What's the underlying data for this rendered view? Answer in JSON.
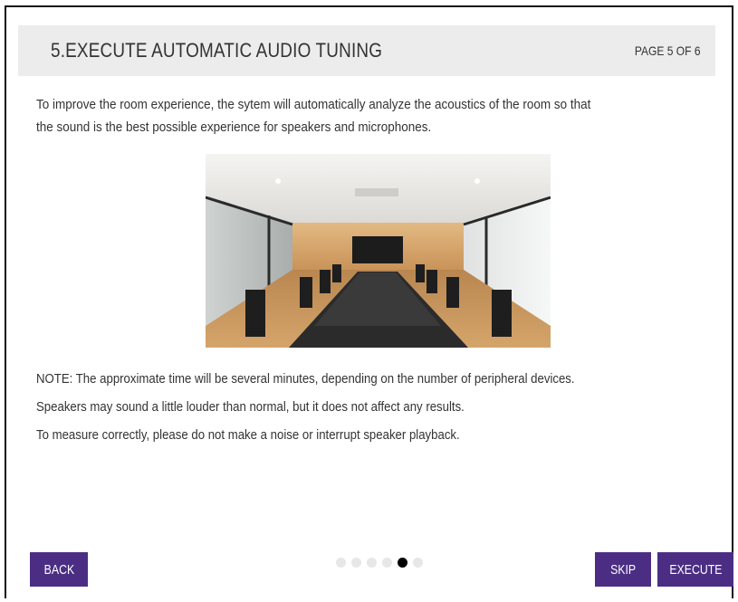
{
  "header": {
    "title": "5.EXECUTE AUTOMATIC AUDIO TUNING",
    "page_indicator": "PAGE 5 OF 6"
  },
  "intro": {
    "line1": "To improve the room experience, the sytem will automatically analyze the acoustics of the room so that",
    "line2": "the sound is the best possible experience for speakers and microphones."
  },
  "notes": [
    "NOTE: The approximate time will be several minutes, depending on the number of peripheral devices.",
    "Speakers may sound a little louder than normal, but it does not affect any results.",
    "To measure correctly, please do not make a noise or interrupt speaker playback."
  ],
  "footer": {
    "back_label": "BACK",
    "skip_label": "SKIP",
    "execute_label": "EXECUTE",
    "page_dots_total": 6,
    "page_dots_active": 5
  },
  "colors": {
    "button_bg": "#4b2e83",
    "header_bg": "#ececec",
    "dot_active": "#000000",
    "dot_inactive": "#e7e7e7"
  }
}
